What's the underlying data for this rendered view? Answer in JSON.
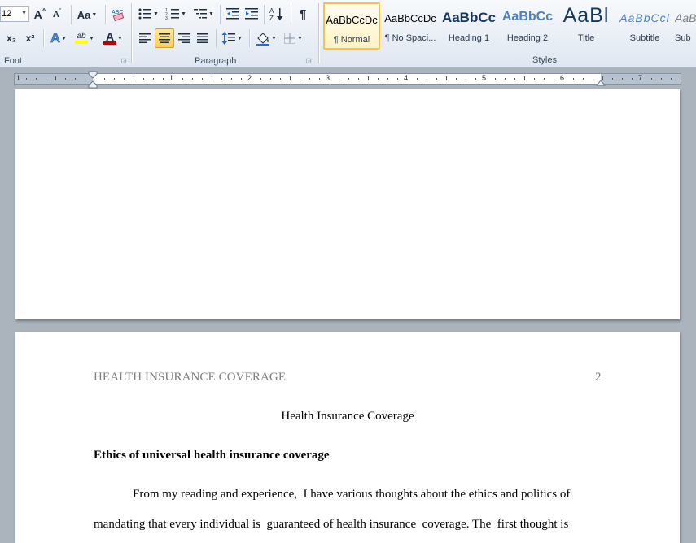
{
  "ribbon": {
    "font": {
      "size_value": "12",
      "grow_font": "A",
      "shrink_font": "A",
      "change_case": "Aa",
      "clear_format": "ABC",
      "subscript": "x₂",
      "superscript": "x²",
      "text_effects": "A",
      "highlight": "ab",
      "font_color": "A",
      "label": "Font"
    },
    "paragraph": {
      "label": "Paragraph",
      "pilcrow": "¶",
      "sort": "A↓Z"
    },
    "styles": {
      "label": "Styles",
      "tiles": [
        {
          "sample": "AaBbCcDc",
          "name": "¶ Normal"
        },
        {
          "sample": "AaBbCcDc",
          "name": "¶ No Spaci..."
        },
        {
          "sample": "AaBbCc",
          "name": "Heading 1"
        },
        {
          "sample": "AaBbCc",
          "name": "Heading 2"
        },
        {
          "sample": "AaBl",
          "name": "Title"
        },
        {
          "sample": "AaBbCcl",
          "name": "Subtitle"
        },
        {
          "sample": "AaBl",
          "name": "Sub"
        }
      ]
    }
  },
  "ruler": {
    "numbers": [
      "1",
      "1",
      "2",
      "3",
      "4",
      "5",
      "6",
      "7"
    ]
  },
  "document": {
    "header_text": "HEALTH INSURANCE COVERAGE",
    "page_number": "2",
    "title": "Health Insurance Coverage",
    "section_heading": "Ethics of universal health insurance coverage",
    "line1": "From my reading and experience,  I have various thoughts about the ethics and politics of",
    "line2": "mandating that every individual is  guaranteed of health insurance  coverage. The  first thought is"
  },
  "colors": {
    "heading_blue": "#17365d",
    "heading2_blue": "#4f81bd",
    "font_red": "#c00000",
    "highlight_yellow": "#ffff00",
    "selected_gold": "#f3c447"
  }
}
